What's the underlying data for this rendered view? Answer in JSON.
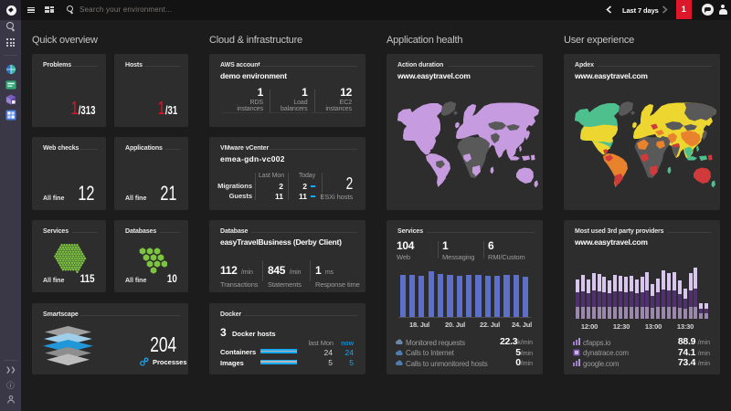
{
  "topbar": {
    "search_placeholder": "Search your environment...",
    "timeframe_label": "Last 7 days",
    "notification_count": "1",
    "icons": [
      "dynatrace-logo",
      "hamburger-menu",
      "dashboard-grid",
      "search",
      "timeframe-prev",
      "timeframe-next",
      "chat-bubble",
      "user-avatar"
    ]
  },
  "sidebar": {
    "icons": [
      "search",
      "apps-grid",
      "smartscape-globe",
      "hosts-green",
      "services-cube",
      "dashboards-grid-blue",
      "expand-chevrons",
      "help",
      "user"
    ]
  },
  "columns": {
    "quick_overview": {
      "header": "Quick overview",
      "problems": {
        "title": "Problems",
        "value": "1",
        "total": "/313"
      },
      "hosts": {
        "title": "Hosts",
        "value": "1",
        "total": "/31"
      },
      "web_checks": {
        "title": "Web checks",
        "status": "All fine",
        "value": "12"
      },
      "applications": {
        "title": "Applications",
        "status": "All fine",
        "value": "21"
      },
      "services": {
        "title": "Services",
        "status": "All fine",
        "value": "115",
        "hex_count": 115
      },
      "databases": {
        "title": "Databases",
        "status": "All fine",
        "value": "10",
        "hex_count": 10
      },
      "smartscape": {
        "title": "Smartscape",
        "value": "204",
        "label": "Processes"
      }
    },
    "cloud_infrastructure": {
      "header": "Cloud & infrastructure",
      "aws": {
        "title": "AWS account",
        "subtitle": "demo environment",
        "metrics": [
          {
            "value": "1",
            "label1": "RDS",
            "label2": "instances"
          },
          {
            "value": "1",
            "label1": "Load",
            "label2": "balancers"
          },
          {
            "value": "12",
            "label1": "EC2",
            "label2": "instances"
          }
        ]
      },
      "vmware": {
        "title": "VMware vCenter",
        "subtitle": "emea-gdn-vc002",
        "col_headers": [
          "Last Mon",
          "Today"
        ],
        "rows": [
          {
            "label": "Migrations",
            "last_mon": "2",
            "today": "2"
          },
          {
            "label": "Guests",
            "last_mon": "11",
            "today": "11"
          }
        ],
        "esxi_value": "2",
        "esxi_label": "ESXi hosts"
      },
      "database": {
        "title": "Database",
        "subtitle": "easyTravelBusiness (Derby Client)",
        "metrics": [
          {
            "value": "112",
            "unit": "/min",
            "label": "Transactions"
          },
          {
            "value": "845",
            "unit": "/min",
            "label": "Statements"
          },
          {
            "value": "1",
            "unit": "ms",
            "label": "Response time"
          }
        ]
      },
      "docker": {
        "title": "Docker",
        "hosts_value": "3",
        "hosts_label": "Docker hosts",
        "col_headers": [
          "last Mon",
          "now"
        ],
        "rows": [
          {
            "label": "Containers",
            "last_mon": "24",
            "now": "24"
          },
          {
            "label": "Images",
            "last_mon": "5",
            "now": "5"
          }
        ]
      }
    },
    "application_health": {
      "header": "Application health",
      "action_duration": {
        "title": "Action duration",
        "subtitle": "www.easytravel.com"
      },
      "services": {
        "title": "Services",
        "metrics": [
          {
            "value": "104",
            "label": "Web"
          },
          {
            "value": "1",
            "label": "Messaging"
          },
          {
            "value": "6",
            "label": "RMI/Custom"
          }
        ],
        "chart_data": {
          "type": "bar",
          "x_ticks": [
            "18. Jul",
            "20. Jul",
            "22. Jul",
            "24. Jul"
          ],
          "values": [
            45,
            45,
            44,
            49,
            46,
            45,
            44,
            45,
            45,
            44,
            44,
            45,
            45,
            43
          ],
          "ymax": 50,
          "bar_color": "#5c6fc9"
        },
        "rows": [
          {
            "icon": "service-cloud",
            "label": "Monitored requests",
            "value": "22.3",
            "unit": "k/min"
          },
          {
            "icon": "service-cloud",
            "label": "Calls to Internet",
            "value": "5",
            "unit": "/min"
          },
          {
            "icon": "service-cloud",
            "label": "Calls to unmonitored hosts",
            "value": "0",
            "unit": "/min"
          }
        ]
      }
    },
    "user_experience": {
      "header": "User experience",
      "apdex": {
        "title": "Apdex",
        "subtitle": "www.easytravel.com"
      },
      "providers": {
        "title": "Most used 3rd party providers",
        "subtitle": "www.easytravel.com",
        "chart_data": {
          "type": "stacked-bar",
          "x_ticks": [
            "12:00",
            "12:30",
            "13:00",
            "13:30"
          ],
          "series": [
            {
              "name": "google.com",
              "color": "#9c87ae",
              "values": [
                13,
                13,
                13,
                13,
                13,
                13,
                13,
                13,
                13,
                13,
                13,
                13,
                13,
                13,
                12,
                13,
                13,
                13,
                13,
                12,
                11,
                13,
                13,
                6,
                6
              ]
            },
            {
              "name": "dynatrace.com",
              "color": "#503070",
              "values": [
                15,
                16,
                14,
                17,
                16,
                15,
                14,
                16,
                16,
                15,
                16,
                14,
                15,
                17,
                12,
                15,
                18,
                17,
                17,
                14,
                10,
                17,
                19,
                5,
                5
              ]
            },
            {
              "name": "cfapps.io",
              "color": "#d9c6ef",
              "values": [
                14,
                17,
                15,
                18,
                18,
                16,
                14,
                17,
                16,
                16,
                16,
                15,
                16,
                19,
                13,
                15,
                20,
                18,
                19,
                15,
                11,
                18,
                22,
                5,
                5
              ]
            }
          ],
          "ymax": 56
        },
        "rows": [
          {
            "icon": "provider-chart",
            "label": "cfapps.io",
            "value": "88.9",
            "unit": "/min"
          },
          {
            "icon": "provider-square",
            "label": "dynatrace.com",
            "value": "74.1",
            "unit": "/min"
          },
          {
            "icon": "provider-chart",
            "label": "google.com",
            "value": "73.4",
            "unit": "/min"
          }
        ]
      }
    }
  },
  "maps": {
    "action_duration_colors": {
      "north_america": "#c79be0",
      "eurasia": "#c79be0",
      "alaska": "#c79be0",
      "canada": "#c79be0",
      "greenland": "#595959",
      "us": "#c79be0",
      "mexico": "#c79be0",
      "central_america_patch": "#c79be0",
      "south_america": "#c79be0",
      "colombia_patch": "#c79be0",
      "bolivia_patch": "#595959",
      "argentina_patch": "#c79be0",
      "uk": "#c79be0",
      "iceland": "#595959",
      "europe": "#c79be0",
      "scandinavia": "#c79be0",
      "ukraine_patch": "#c79be0",
      "africa": "#595959",
      "algeria_patch": "#595959",
      "nigeria_patch": "#c79be0",
      "sudan_patch": "#595959",
      "south_africa_patch": "#c79be0",
      "madagascar": "#c79be0",
      "middle_east": "#c79be0",
      "turkey_patch": "#c79be0",
      "iran": "#595959",
      "russia_west": "#c79be0",
      "russia_east": "#c79be0",
      "kazakhstan": "#595959",
      "mongolia": "#595959",
      "china": "#c79be0",
      "india": "#c79be0",
      "nepal_patch": "#c79be0",
      "se_asia": "#c79be0",
      "philippines": "#c79be0",
      "indonesia": "#c79be0",
      "papua_patch": "#c79be0",
      "japan": "#c79be0",
      "australia": "#c79be0",
      "nz": "#c79be0"
    },
    "apdex_colors": {
      "north_america": "#4ec08e",
      "eurasia": "#eed630",
      "alaska": "#4ec08e",
      "canada": "#4ec08e",
      "greenland": "#595959",
      "us": "#eed630",
      "mexico": "#eed630",
      "central_america_patch": "#d03a3a",
      "south_america": "#e8822d",
      "colombia_patch": "#d03a3a",
      "bolivia_patch": "#e8822d",
      "argentina_patch": "#d03a3a",
      "uk": "#eed630",
      "iceland": "#595959",
      "europe": "#eed630",
      "scandinavia": "#eed630",
      "ukraine_patch": "#d03a3a",
      "africa": "#595959",
      "algeria_patch": "#e8822d",
      "nigeria_patch": "#d03a3a",
      "sudan_patch": "#e8822d",
      "south_africa_patch": "#d03a3a",
      "madagascar": "#4ec08e",
      "middle_east": "#595959",
      "turkey_patch": "#e8822d",
      "iran": "#e8822d",
      "russia_west": "#eed630",
      "russia_east": "#595959",
      "kazakhstan": "#595959",
      "mongolia": "#595959",
      "china": "#e8822d",
      "india": "#595959",
      "nepal_patch": "#d03a3a",
      "se_asia": "#4ec08e",
      "philippines": "#4ec08e",
      "indonesia": "#4ec08e",
      "papua_patch": "#d03a3a",
      "japan": "#595959",
      "australia": "#d03a3a",
      "nz": "#4ec08e"
    }
  },
  "palette": {
    "red": "#dc172a",
    "blue": "#14a8f5",
    "green_hex": "#7dc540",
    "bar_blue": "#5c6fc9",
    "tile_bg": "#2d2d2d",
    "sidebar_bg": "#3a3847"
  }
}
